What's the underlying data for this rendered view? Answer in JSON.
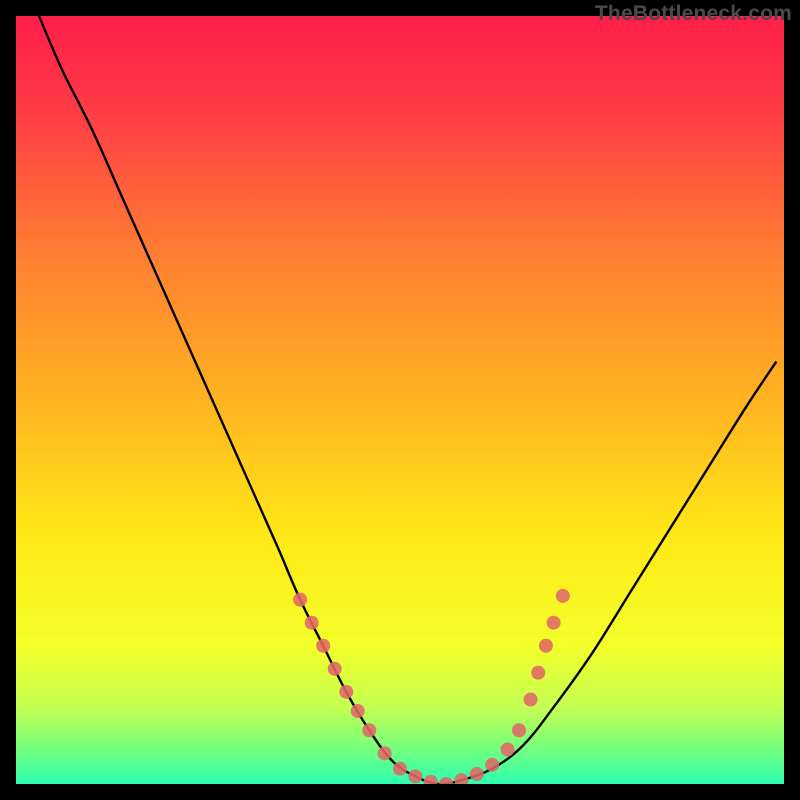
{
  "watermark": "TheBottleneck.com",
  "chart_data": {
    "type": "line",
    "title": "",
    "xlabel": "",
    "ylabel": "",
    "xlim": [
      0,
      100
    ],
    "ylim": [
      0,
      100
    ],
    "grid": false,
    "legend": false,
    "background_gradient": {
      "stops": [
        {
          "offset": 0.0,
          "color": "#ff1f4b"
        },
        {
          "offset": 0.12,
          "color": "#ff3a45"
        },
        {
          "offset": 0.3,
          "color": "#ff7b33"
        },
        {
          "offset": 0.5,
          "color": "#ffb321"
        },
        {
          "offset": 0.68,
          "color": "#ffe917"
        },
        {
          "offset": 0.82,
          "color": "#f3ff2a"
        },
        {
          "offset": 0.9,
          "color": "#c4ff52"
        },
        {
          "offset": 0.95,
          "color": "#7bff7a"
        },
        {
          "offset": 1.0,
          "color": "#2dffb0"
        }
      ]
    },
    "series": [
      {
        "name": "bottleneck-curve",
        "x": [
          3,
          6,
          10,
          14,
          18,
          22,
          26,
          30,
          34,
          37,
          40,
          43,
          46,
          49,
          52,
          55,
          58,
          62,
          66,
          70,
          75,
          80,
          85,
          90,
          95,
          99
        ],
        "y": [
          100,
          93,
          85,
          76,
          67,
          58,
          49,
          40,
          31,
          24,
          18,
          12,
          7,
          3,
          1,
          0,
          0.5,
          2,
          5,
          10,
          17,
          25,
          33,
          41,
          49,
          55
        ]
      }
    ],
    "markers": {
      "name": "highlight-dots",
      "color": "#e06868",
      "radius": 7,
      "points": [
        {
          "x": 37,
          "y": 24
        },
        {
          "x": 38.5,
          "y": 21
        },
        {
          "x": 40,
          "y": 18
        },
        {
          "x": 41.5,
          "y": 15
        },
        {
          "x": 43,
          "y": 12
        },
        {
          "x": 44.5,
          "y": 9.5
        },
        {
          "x": 46,
          "y": 7
        },
        {
          "x": 48,
          "y": 4
        },
        {
          "x": 50,
          "y": 2
        },
        {
          "x": 52,
          "y": 1
        },
        {
          "x": 54,
          "y": 0.3
        },
        {
          "x": 56,
          "y": 0
        },
        {
          "x": 58,
          "y": 0.5
        },
        {
          "x": 60,
          "y": 1.3
        },
        {
          "x": 62,
          "y": 2.5
        },
        {
          "x": 64,
          "y": 4.5
        },
        {
          "x": 65.5,
          "y": 7
        },
        {
          "x": 67,
          "y": 11
        },
        {
          "x": 68,
          "y": 14.5
        },
        {
          "x": 69,
          "y": 18
        },
        {
          "x": 70,
          "y": 21
        },
        {
          "x": 71.2,
          "y": 24.5
        }
      ]
    }
  }
}
